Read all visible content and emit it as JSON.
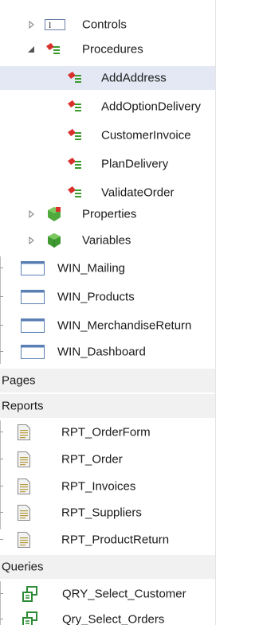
{
  "tree": {
    "controls_label": "Controls",
    "procedures_label": "Procedures",
    "procedures": [
      "AddAddress",
      "AddOptionDelivery",
      "CustomerInvoice",
      "PlanDelivery",
      "ValidateOrder"
    ],
    "selected_procedure": "AddAddress",
    "properties_label": "Properties",
    "variables_label": "Variables",
    "windows": [
      "WIN_Mailing",
      "WIN_Products",
      "WIN_MerchandiseReturn",
      "WIN_Dashboard"
    ],
    "pages_label": "Pages",
    "reports_label": "Reports",
    "reports": [
      "RPT_OrderForm",
      "RPT_Order",
      "RPT_Invoices",
      "RPT_Suppliers",
      "RPT_ProductReturn"
    ],
    "queries_label": "Queries",
    "queries": [
      "QRY_Select_Customer",
      "Qry_Select_Orders"
    ]
  },
  "icons": {
    "expand": "triangle-right-icon",
    "collapse": "triangle-down-icon",
    "control": "control-icon",
    "procedure": "procedure-icon",
    "property": "property-icon",
    "variable": "variable-icon",
    "window": "window-icon",
    "report": "report-icon",
    "query": "query-icon"
  },
  "colors": {
    "selection": "#e3e8f4",
    "section_bg": "#f1f1f1",
    "procedure_red": "#d8312c",
    "procedure_green": "#3a9a2c",
    "window_blue": "#5a7fb4",
    "query_green": "#2d8a36"
  }
}
